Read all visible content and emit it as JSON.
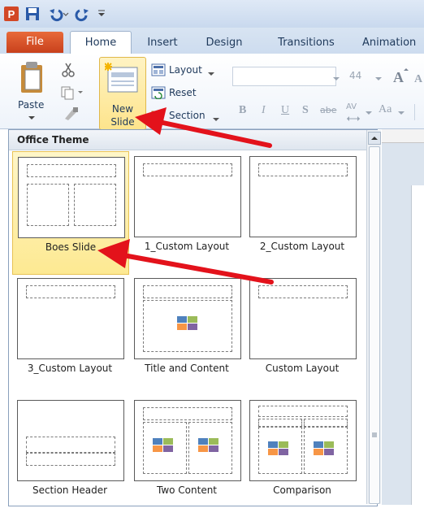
{
  "tabs": {
    "file": "File",
    "home": "Home",
    "insert": "Insert",
    "design": "Design",
    "transitions": "Transitions",
    "animations": "Animation"
  },
  "ribbon": {
    "paste": "Paste",
    "new_slide_line1": "New",
    "new_slide_line2": "Slide",
    "layout": "Layout",
    "reset": "Reset",
    "section": "Section",
    "font_size": "44",
    "bold": "B",
    "italic": "I",
    "underline": "U",
    "shadow": "S",
    "strike": "abe",
    "spacing": "AV",
    "change_case": "Aa"
  },
  "gallery": {
    "header": "Office Theme",
    "layouts": [
      {
        "label": "Boes Slide",
        "selected": true
      },
      {
        "label": "1_Custom Layout"
      },
      {
        "label": "2_Custom Layout"
      },
      {
        "label": "3_Custom Layout"
      },
      {
        "label": "Title and Content"
      },
      {
        "label": "Custom Layout"
      },
      {
        "label": "Section Header"
      },
      {
        "label": "Two Content"
      },
      {
        "label": "Comparison"
      }
    ]
  },
  "colors": {
    "file_tab": "#d9532b",
    "arrow": "#e3121b",
    "selection": "#fde992"
  }
}
